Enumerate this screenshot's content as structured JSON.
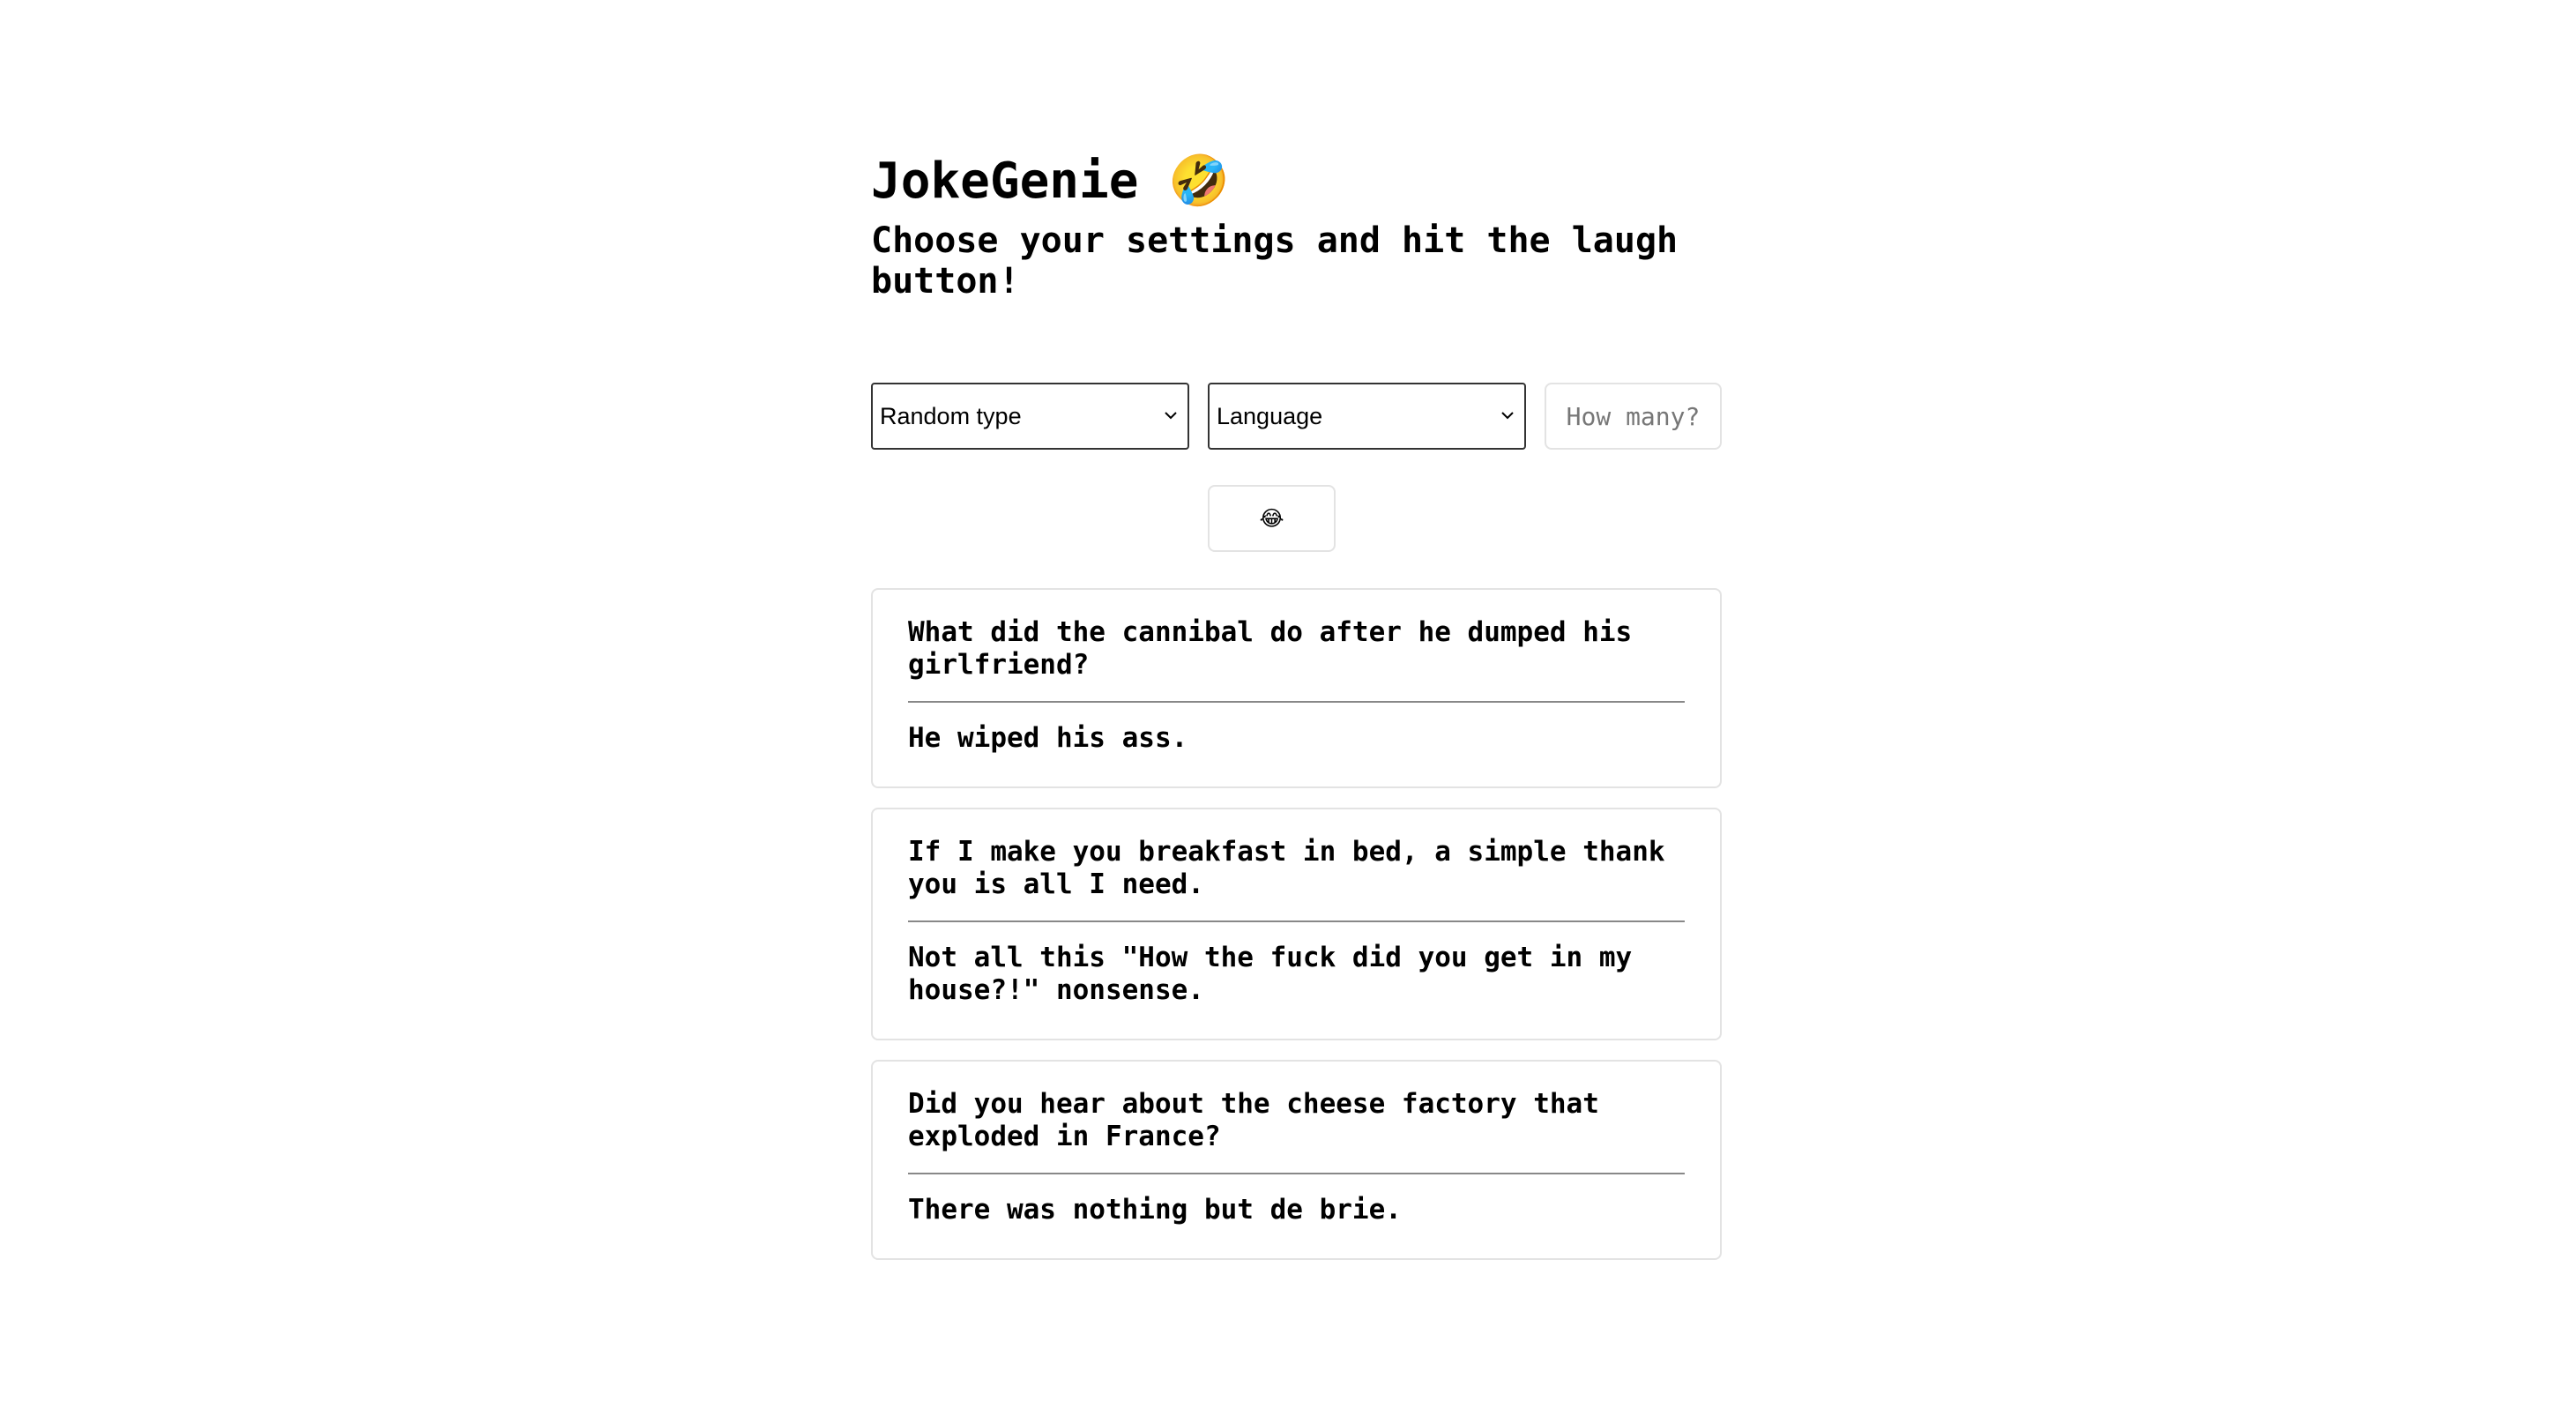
{
  "header": {
    "title": "JokeGenie",
    "title_emoji": "🤣",
    "subtitle": "Choose your settings and hit the laugh button!"
  },
  "controls": {
    "type_select": {
      "selected": "Random type"
    },
    "language_select": {
      "selected": "Language"
    },
    "count_input": {
      "placeholder": "How many?",
      "value": ""
    },
    "laugh_button": {
      "label": "😂"
    }
  },
  "jokes": [
    {
      "setup": "What did the cannibal do after he dumped his girlfriend?",
      "punchline": "He wiped his ass."
    },
    {
      "setup": "If I make you breakfast in bed, a simple thank you is all I need.",
      "punchline": "Not all this \"How the fuck did you get in my house?!\" nonsense."
    },
    {
      "setup": "Did you hear about the cheese factory that exploded in France?",
      "punchline": "There was nothing but de brie."
    }
  ],
  "colors": {
    "border_light": "#e3e3e3",
    "border_dark": "#333333",
    "divider": "#888888",
    "text": "#000000"
  },
  "icons": {
    "select_arrow": "chevron-down-icon"
  }
}
